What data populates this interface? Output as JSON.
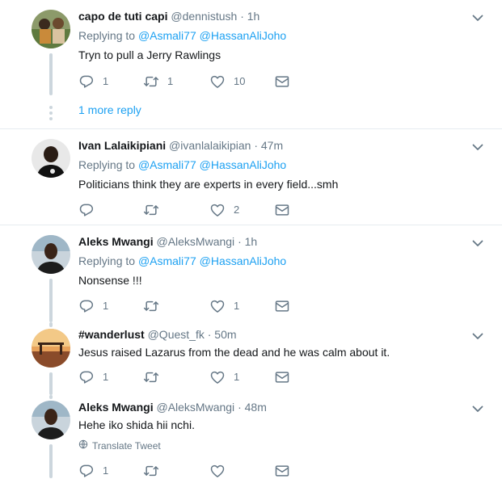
{
  "tweets": [
    {
      "name": "capo de tuti capi",
      "handle": "@dennistush",
      "time": "1h",
      "replying_prefix": "Replying to",
      "mentions": [
        "@Asmali77",
        "@HassanAliJoho"
      ],
      "text": "Tryn to pull a Jerry Rawlings",
      "reply_count": "1",
      "retweet_count": "1",
      "like_count": "10",
      "more_reply": "1 more reply"
    },
    {
      "name": "Ivan Lalaikipiani",
      "handle": "@ivanlalaikipian",
      "time": "47m",
      "replying_prefix": "Replying to",
      "mentions": [
        "@Asmali77",
        "@HassanAliJoho"
      ],
      "text": "Politicians think they are experts in every field...smh",
      "reply_count": "",
      "retweet_count": "",
      "like_count": "2"
    },
    {
      "name": "Aleks Mwangi",
      "handle": "@AleksMwangi",
      "time": "1h",
      "replying_prefix": "Replying to",
      "mentions": [
        "@Asmali77",
        "@HassanAliJoho"
      ],
      "text": "Nonsense !!!",
      "reply_count": "1",
      "retweet_count": "",
      "like_count": "1"
    },
    {
      "name": "#wanderlust",
      "handle": "@Quest_fk",
      "time": "50m",
      "text": "Jesus raised Lazarus from the dead and he was calm about it.",
      "reply_count": "1",
      "retweet_count": "",
      "like_count": "1"
    },
    {
      "name": "Aleks Mwangi",
      "handle": "@AleksMwangi",
      "time": "48m",
      "text": "Hehe iko shida hii nchi.",
      "translate": "Translate Tweet",
      "reply_count": "1",
      "retweet_count": "",
      "like_count": ""
    }
  ],
  "separator_dot": "·",
  "icons": {
    "reply": "reply-icon",
    "retweet": "retweet-icon",
    "like": "heart-icon",
    "dm": "envelope-icon",
    "more": "chevron-down-icon",
    "translate": "globe-icon"
  },
  "colors": {
    "accent": "#1da1f2",
    "muted": "#657786",
    "text": "#14171a",
    "thread_line": "#ccd6dd",
    "divider": "#e6ecf0"
  }
}
